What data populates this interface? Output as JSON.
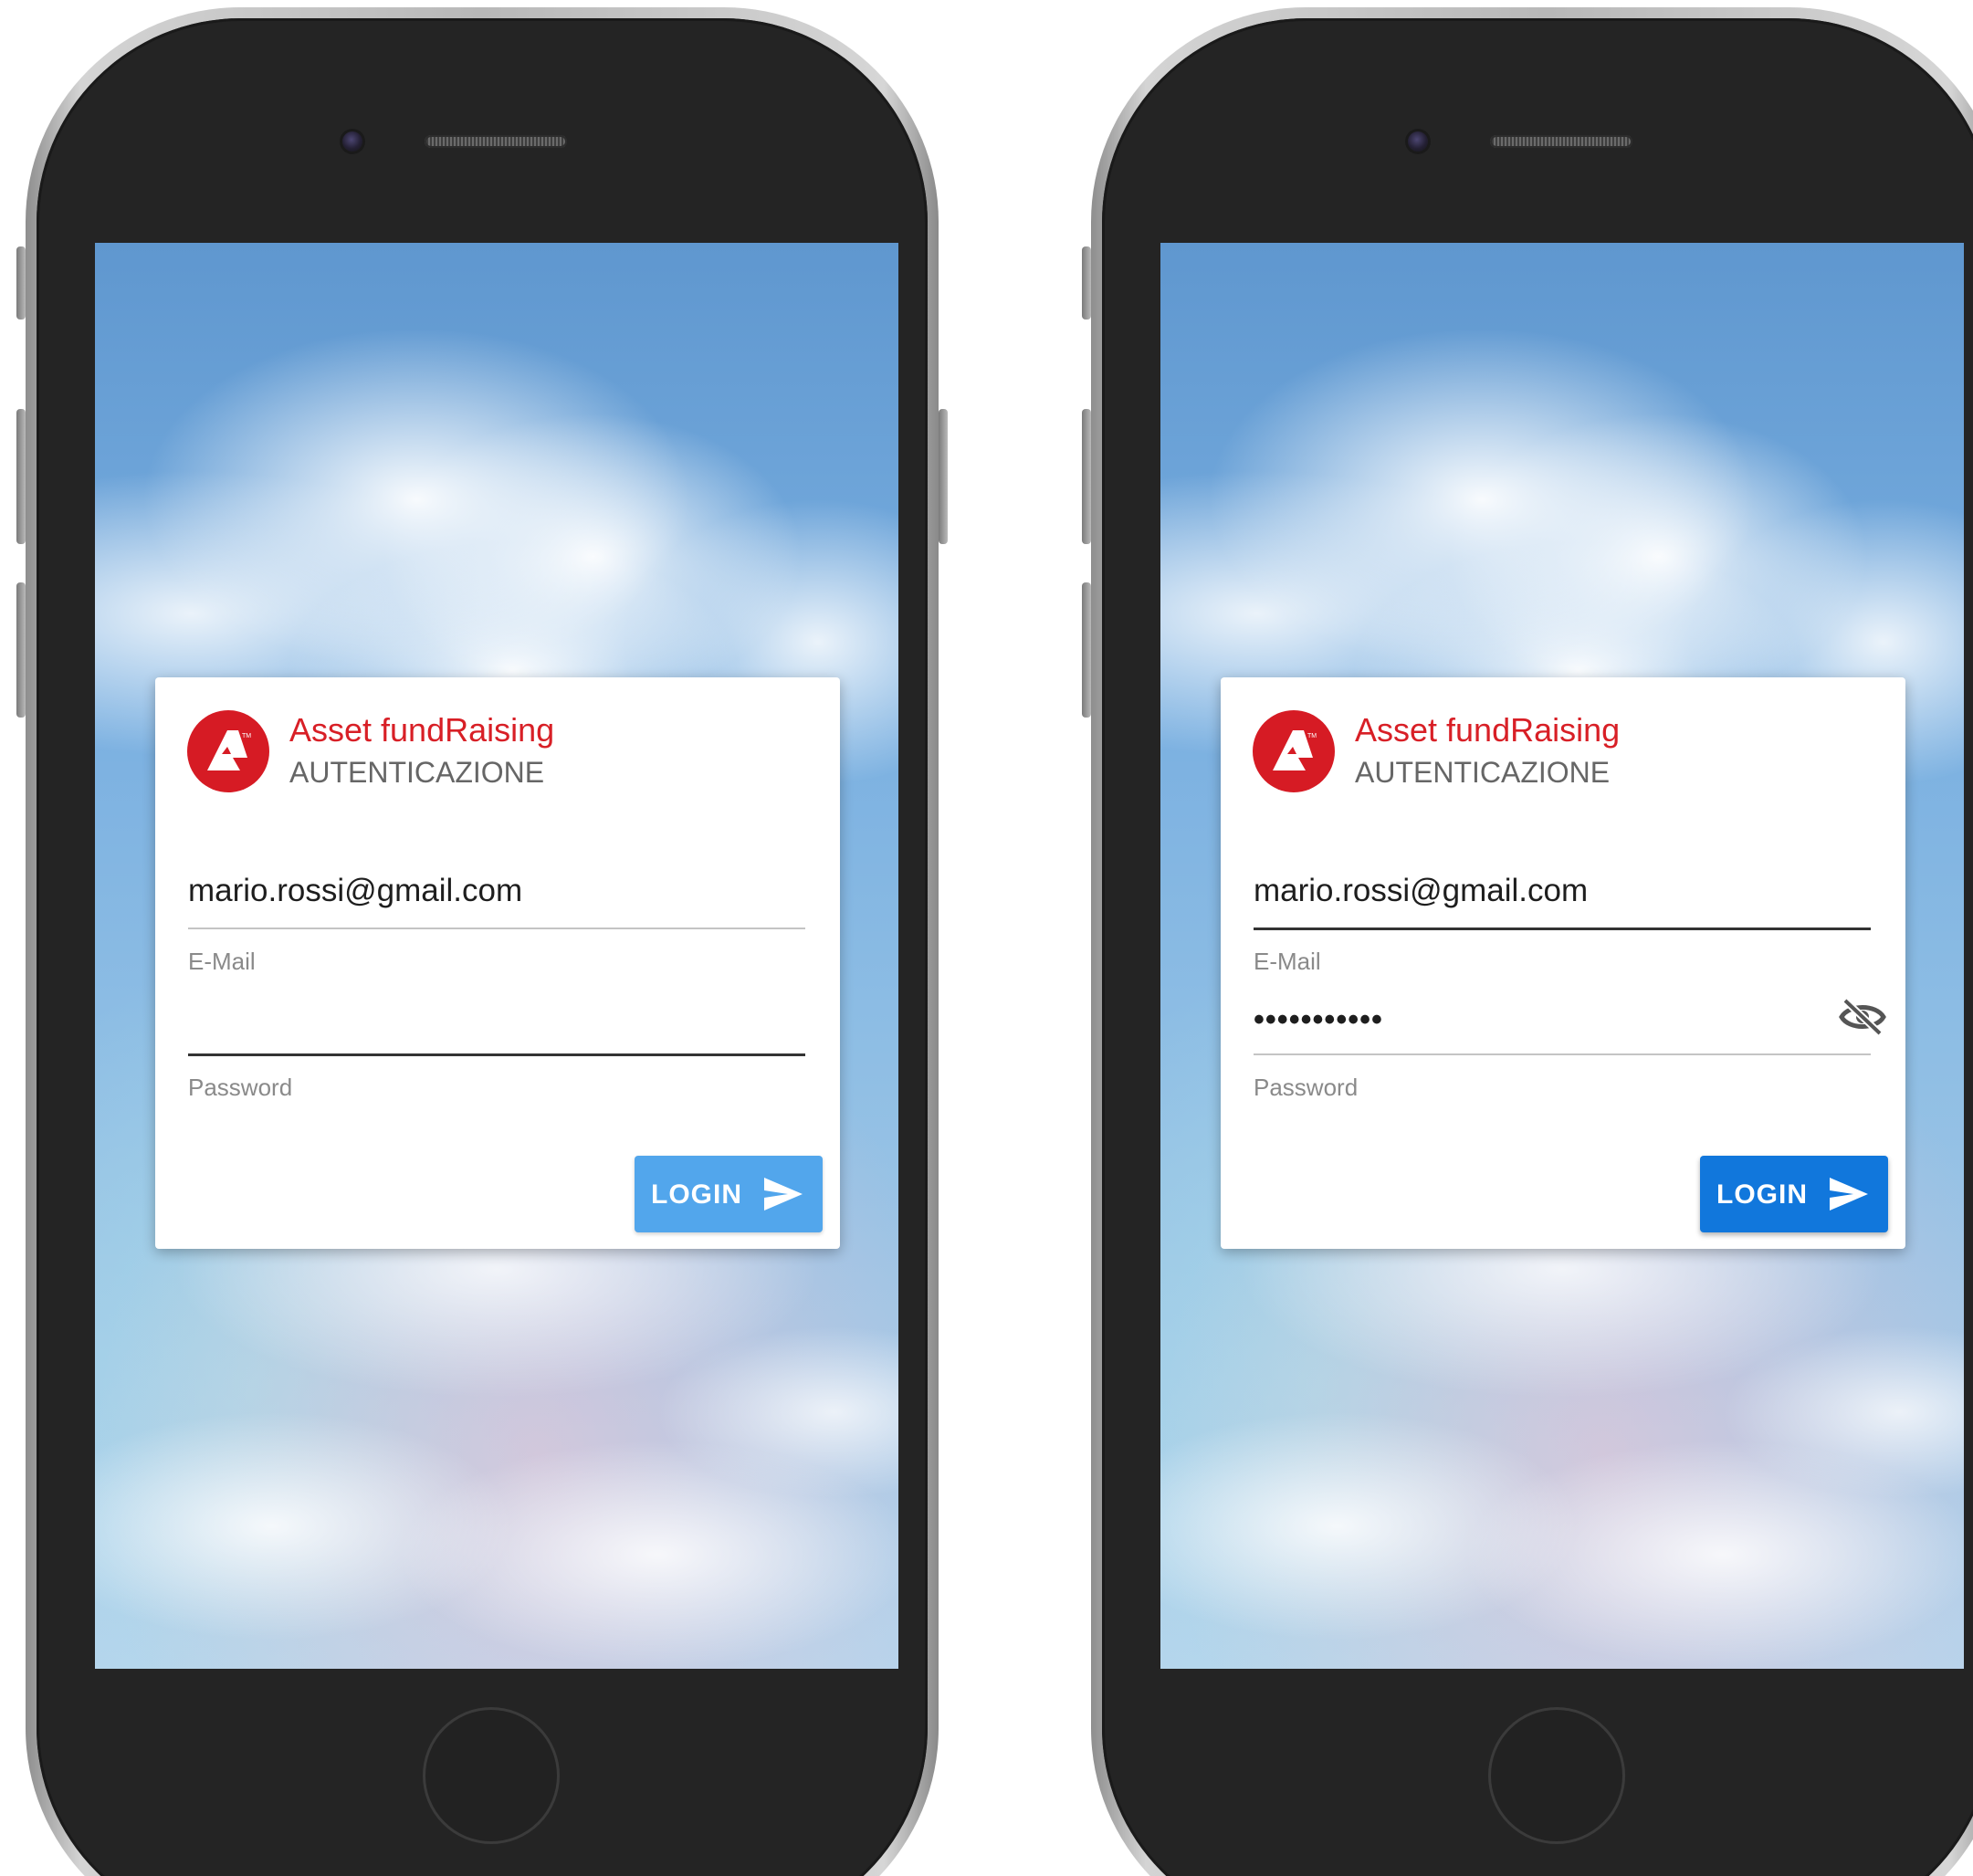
{
  "phones": [
    {
      "state": "password-focused-empty",
      "card": {
        "brand_title": "Asset fundRaising",
        "brand_subtitle": "AUTENTICAZIONE",
        "email": {
          "value": "mario.rossi@gmail.com",
          "label": "E-Mail"
        },
        "password": {
          "value": "",
          "label": "Password"
        },
        "login_button": {
          "label": "LOGIN",
          "icon": "send-icon",
          "enabled": false
        }
      }
    },
    {
      "state": "password-filled",
      "card": {
        "brand_title": "Asset fundRaising",
        "brand_subtitle": "AUTENTICAZIONE",
        "email": {
          "value": "mario.rossi@gmail.com",
          "label": "E-Mail"
        },
        "password": {
          "value": "•••••••••••",
          "label": "Password",
          "toggle_icon": "eye-off-icon"
        },
        "login_button": {
          "label": "LOGIN",
          "icon": "send-icon",
          "enabled": true
        }
      }
    }
  ],
  "colors": {
    "brand_red": "#d81f26",
    "button_disabled": "#52a6ec",
    "button_enabled": "#1177dc",
    "phone_face": "#242424"
  }
}
